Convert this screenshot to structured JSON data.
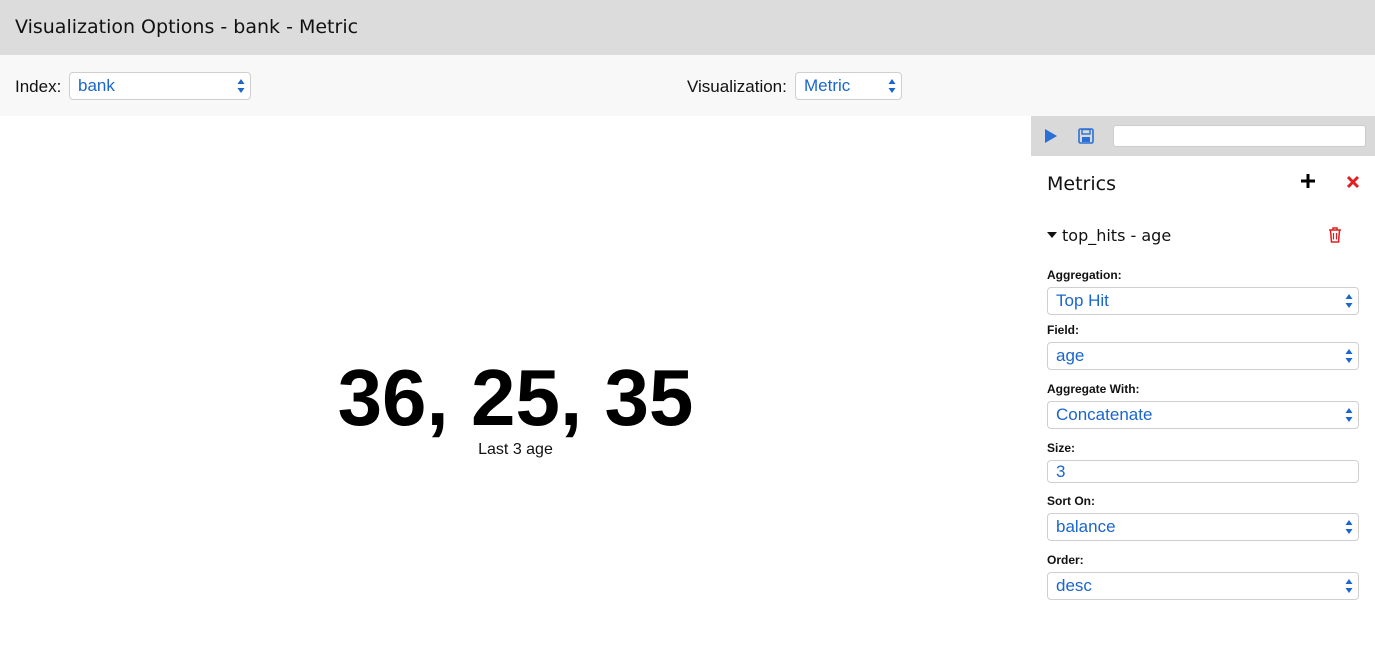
{
  "window": {
    "title": "Visualization Options - bank - Metric"
  },
  "options": {
    "index_label": "Index:",
    "index_value": "bank",
    "visualization_label": "Visualization:",
    "visualization_value": "Metric"
  },
  "metric": {
    "value": "36, 25, 35",
    "label": "Last 3 age"
  },
  "sidebar": {
    "metrics_title": "Metrics",
    "aggregation_header": "top_hits - age",
    "fields": {
      "aggregation": {
        "label": "Aggregation:",
        "value": "Top Hit"
      },
      "field": {
        "label": "Field:",
        "value": "age"
      },
      "aggregate_with": {
        "label": "Aggregate With:",
        "value": "Concatenate"
      },
      "size": {
        "label": "Size:",
        "value": "3"
      },
      "sort_on": {
        "label": "Sort On:",
        "value": "balance"
      },
      "order": {
        "label": "Order:",
        "value": "desc"
      }
    }
  },
  "colors": {
    "accent": "#1a66cc",
    "danger": "#e02020",
    "titlebar": "#dcdcdc"
  },
  "icons": [
    "play-icon",
    "save-icon",
    "plus-icon",
    "close-icon",
    "trash-icon",
    "caret-down-icon",
    "select-arrows-icon"
  ]
}
